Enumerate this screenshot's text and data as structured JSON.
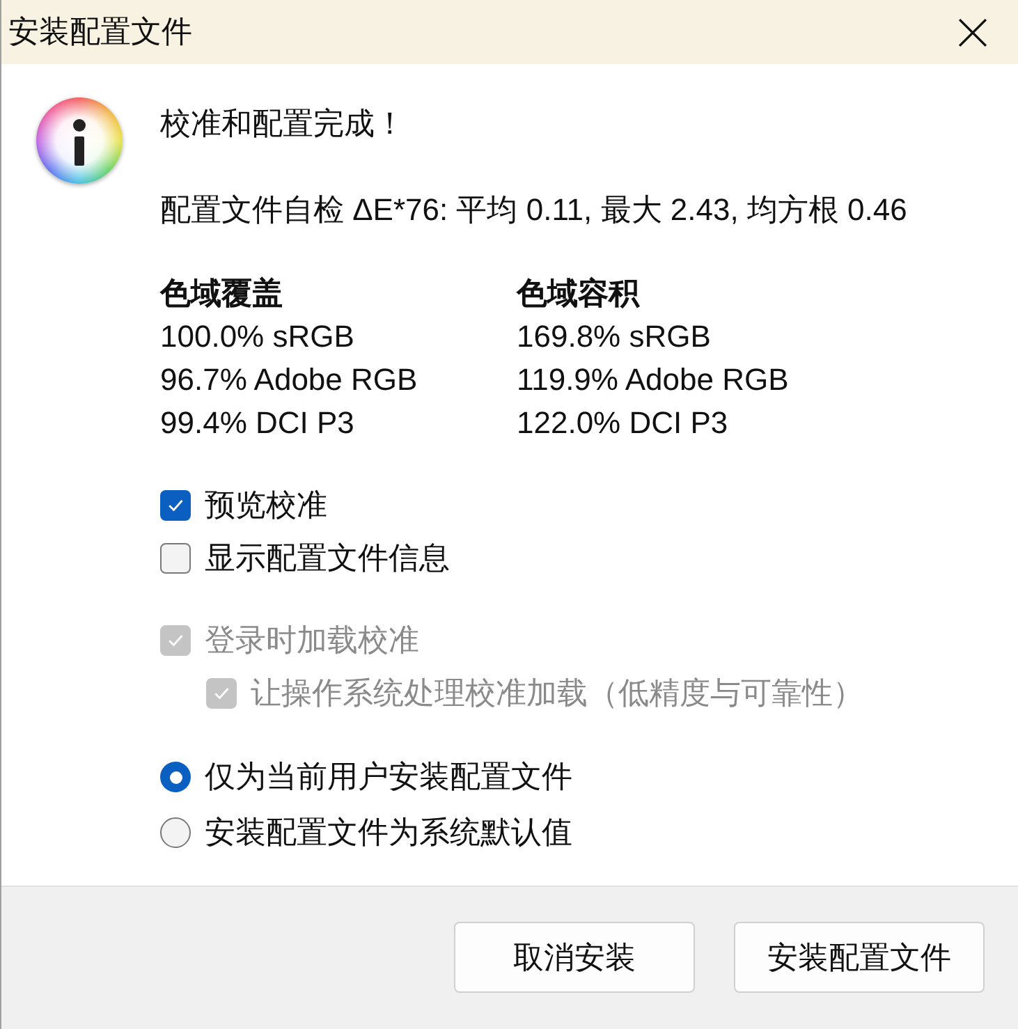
{
  "window": {
    "title": "安装配置文件"
  },
  "message": {
    "heading": "校准和配置完成！",
    "self_check": "配置文件自检 ΔE*76: 平均 0.11, 最大 2.43, 均方根 0.46"
  },
  "gamut": [
    {
      "heading": "色域覆盖",
      "values": [
        "100.0% sRGB",
        "96.7% Adobe RGB",
        "99.4% DCI P3"
      ]
    },
    {
      "heading": "色域容积",
      "values": [
        "169.8% sRGB",
        "119.9% Adobe RGB",
        "122.0% DCI P3"
      ]
    }
  ],
  "display_options": [
    {
      "label": "预览校准",
      "checked": true,
      "disabled": false
    },
    {
      "label": "显示配置文件信息",
      "checked": false,
      "disabled": false
    }
  ],
  "load_options": [
    {
      "label": "登录时加载校准",
      "checked": true,
      "disabled": true,
      "children": [
        {
          "label": "让操作系统处理校准加载（低精度与可靠性）",
          "checked": true,
          "disabled": true
        }
      ]
    }
  ],
  "install_scope": [
    {
      "label": "仅为当前用户安装配置文件",
      "selected": true
    },
    {
      "label": "安装配置文件为系统默认值",
      "selected": false
    }
  ],
  "buttons": [
    {
      "label": "取消安装"
    },
    {
      "label": "安装配置文件"
    }
  ]
}
